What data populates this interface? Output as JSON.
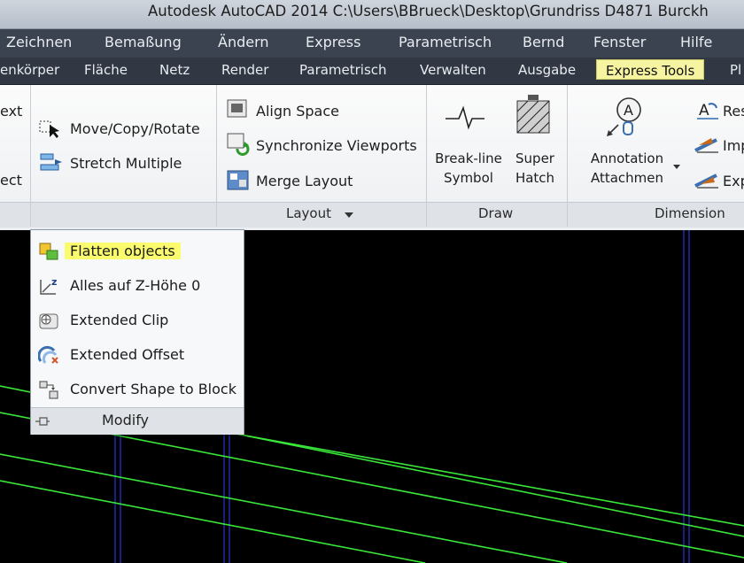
{
  "title": "Autodesk AutoCAD 2014    C:\\Users\\BBrueck\\Desktop\\Grundriss D4871 Burckh",
  "menu": [
    "Zeichnen",
    "Bemaßung",
    "Ändern",
    "Express",
    "Parametrisch",
    "Bernd",
    "Fenster",
    "Hilfe"
  ],
  "tabs": [
    "enkörper",
    "Fläche",
    "Netz",
    "Render",
    "Parametrisch",
    "Verwalten",
    "Ausgabe",
    "Express Tools",
    "Pl"
  ],
  "active_tab": "Express Tools",
  "ribbon": {
    "left_partial_top": "ext",
    "left_partial_bottom": "ect",
    "move_copy_rotate": "Move/Copy/Rotate",
    "stretch_multiple": "Stretch Multiple",
    "align_space": "Align Space",
    "synchronize_viewports": "Synchronize Viewports",
    "merge_layout": "Merge Layout",
    "layout_panel": "Layout",
    "breakline_1": "Break-line",
    "breakline_2": "Symbol",
    "superhatch_1": "Super",
    "superhatch_2": "Hatch",
    "draw_panel": "Draw",
    "annotation_1": "Annotation",
    "annotation_2": "Attachmen",
    "res": "Res",
    "imp": "Imp",
    "exp": "Exp",
    "dimension_panel": "Dimension"
  },
  "dropdown": {
    "items": [
      "Flatten objects",
      "Alles auf Z-Höhe 0",
      "Extended Clip",
      "Extended Offset",
      "Convert Shape to Block"
    ],
    "highlighted": "Flatten objects",
    "panel_label": "Modify"
  },
  "colors": {
    "highlight": "#fbfb6e",
    "canvas": "#000000",
    "green_lines": "#39e639",
    "blue_lines": "#2433c8"
  }
}
